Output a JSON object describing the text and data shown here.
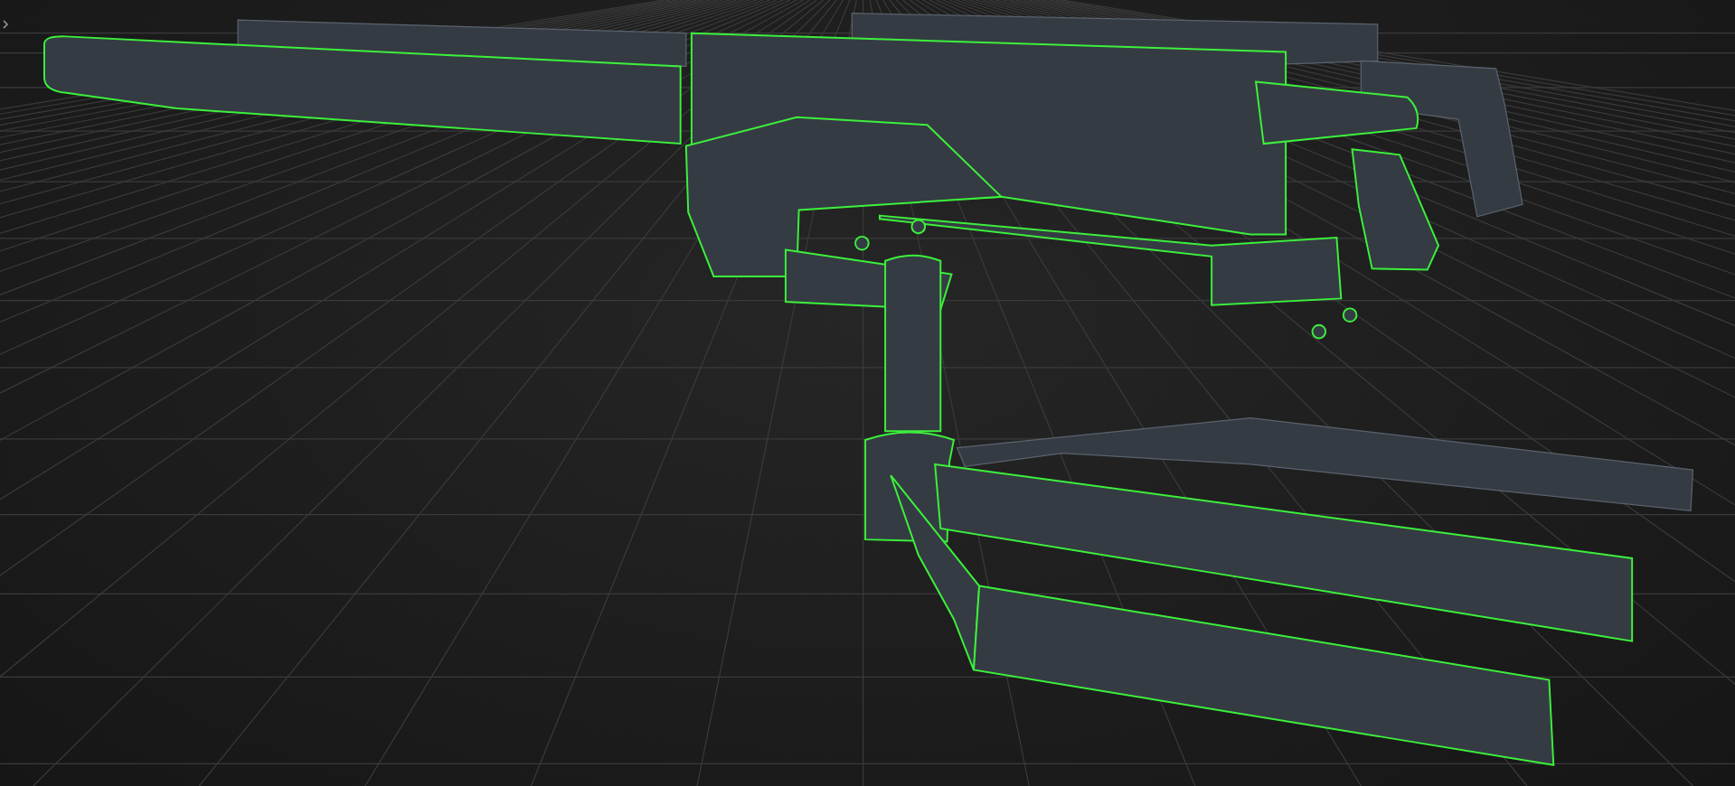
{
  "viewport": {
    "panel_collapsed": true,
    "parts": [
      {
        "kind": "shroud",
        "selected": false
      },
      {
        "kind": "top_cover",
        "selected": false
      },
      {
        "kind": "stock",
        "selected": false
      },
      {
        "kind": "rear_frame",
        "selected": false
      },
      {
        "kind": "suppressor",
        "selected": true
      },
      {
        "kind": "receiver",
        "selected": true
      },
      {
        "kind": "front_block",
        "selected": true
      },
      {
        "kind": "rear_grip",
        "selected": true
      },
      {
        "kind": "pistol_grip",
        "selected": true
      },
      {
        "kind": "cradle",
        "selected": true
      },
      {
        "kind": "linkage",
        "selected": true
      },
      {
        "kind": "post",
        "selected": true
      },
      {
        "kind": "base",
        "selected": true
      },
      {
        "kind": "brace",
        "selected": true
      },
      {
        "kind": "leg_front",
        "selected": true
      },
      {
        "kind": "leg_back",
        "selected": true
      },
      {
        "kind": "rings",
        "selected": true
      }
    ]
  }
}
